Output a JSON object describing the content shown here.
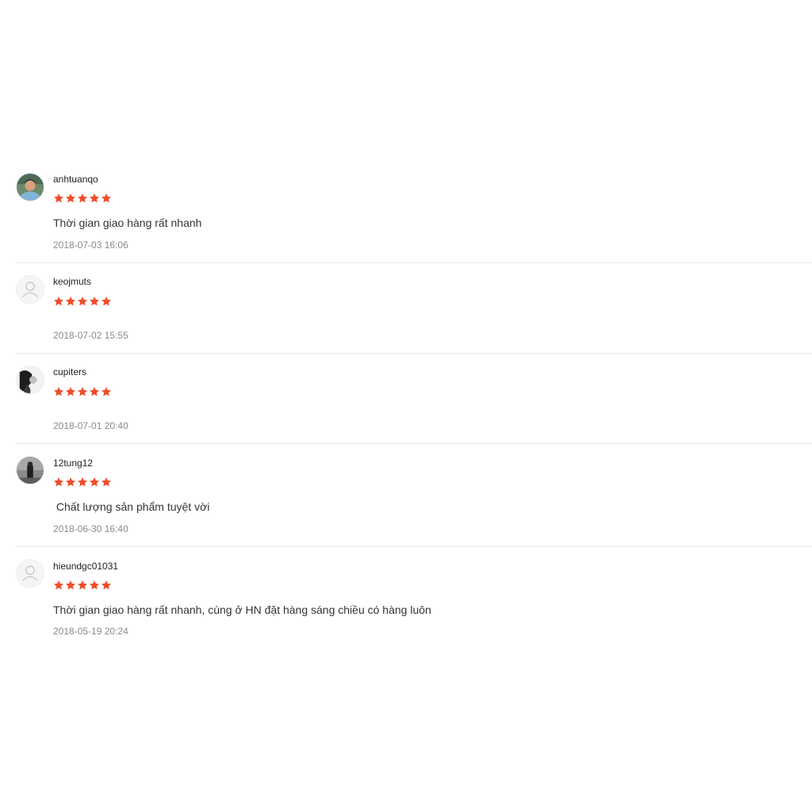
{
  "colors": {
    "star": "#ee4d2d",
    "divider": "#e8e8e8",
    "timestamp": "#8a8a8a"
  },
  "reviews": [
    {
      "username": "anhtuanqo",
      "rating": 5,
      "comment": "Thời gian giao hàng rất nhanh",
      "timestamp": "2018-07-03 16:06",
      "avatar": "user-photo-icon"
    },
    {
      "username": "keojmuts",
      "rating": 5,
      "comment": "",
      "timestamp": "2018-07-02 15:55",
      "avatar": "default-user-icon"
    },
    {
      "username": "cupiters",
      "rating": 5,
      "comment": "",
      "timestamp": "2018-07-01 20:40",
      "avatar": "user-photo-icon"
    },
    {
      "username": "12tung12",
      "rating": 5,
      "comment": " Chất lượng sản phẩm tuyệt vời",
      "timestamp": "2018-06-30 16:40",
      "avatar": "user-photo-icon"
    },
    {
      "username": "hieundgc01031",
      "rating": 5,
      "comment": "Thời gian giao hàng rất nhanh, cùng ở HN đặt hàng sáng chiều có hàng luôn",
      "timestamp": "2018-05-19 20:24",
      "avatar": "default-user-icon"
    }
  ]
}
